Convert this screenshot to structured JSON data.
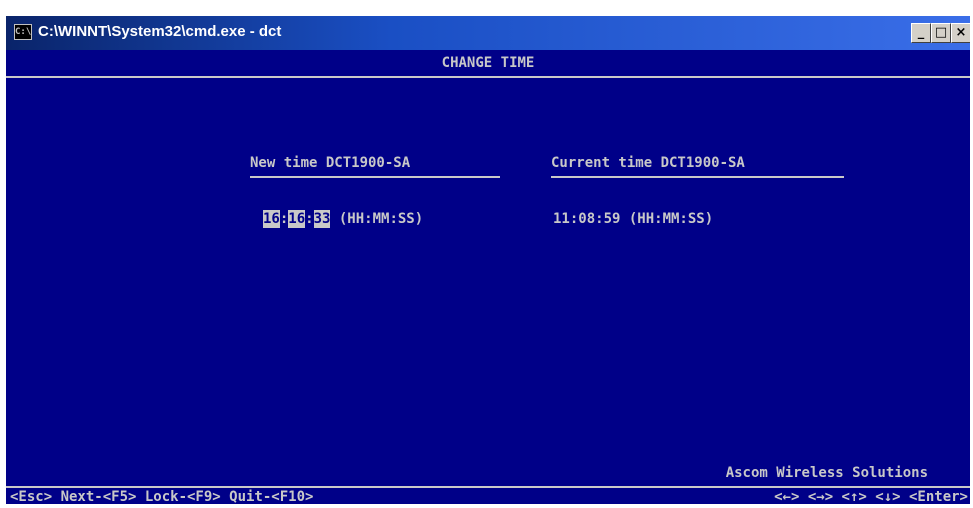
{
  "window": {
    "title": "C:\\WINNT\\System32\\cmd.exe - dct",
    "icon_text": "C:\\",
    "controls": {
      "minimize": "_",
      "maximize": "□",
      "close": "×"
    }
  },
  "screen": {
    "title": "CHANGE TIME",
    "new_time": {
      "label": "New time DCT1900-SA",
      "hh": "16",
      "mm": "16",
      "ss": "33",
      "separator": ":",
      "format": " (HH:MM:SS)"
    },
    "current_time": {
      "label": "Current time DCT1900-SA",
      "value": "11:08:59 (HH:MM:SS)"
    },
    "vendor": "Ascom Wireless Solutions",
    "footer_left": "<Esc> Next-<F5> Lock-<F9> Quit-<F10>",
    "footer_right": "<←> <→> <↑> <↓> <Enter>"
  },
  "colors": {
    "console_bg": "#000088",
    "console_fg": "#c8c8c8",
    "titlebar": "#0a246a"
  }
}
